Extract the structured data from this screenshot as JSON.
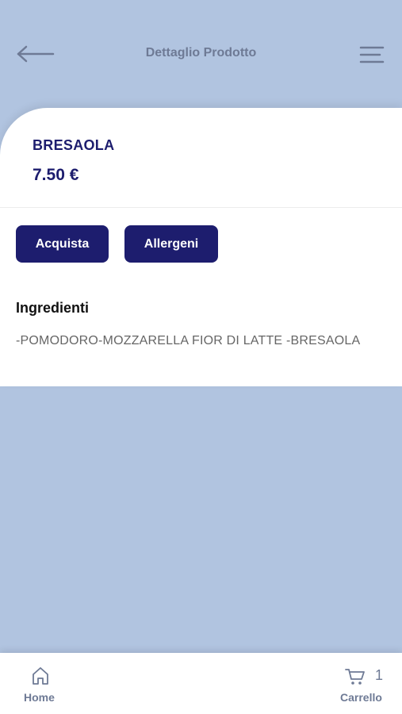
{
  "header": {
    "title": "Dettaglio Prodotto"
  },
  "product": {
    "name": "BRESAOLA",
    "price": "7.50 €"
  },
  "actions": {
    "buy_label": "Acquista",
    "allergens_label": "Allergeni"
  },
  "ingredients": {
    "title": "Ingredienti",
    "text": "-POMODORO-MOZZARELLA FIOR DI LATTE -BRESAOLA"
  },
  "bottom_nav": {
    "home_label": "Home",
    "cart_label": "Carrello",
    "cart_count": "1"
  },
  "colors": {
    "background": "#b1c4e0",
    "accent": "#1d1d6e",
    "muted_text": "#6e7a95"
  },
  "icons": {
    "back": "arrow-left-icon",
    "menu": "menu-icon",
    "home": "home-icon",
    "cart": "cart-icon"
  }
}
